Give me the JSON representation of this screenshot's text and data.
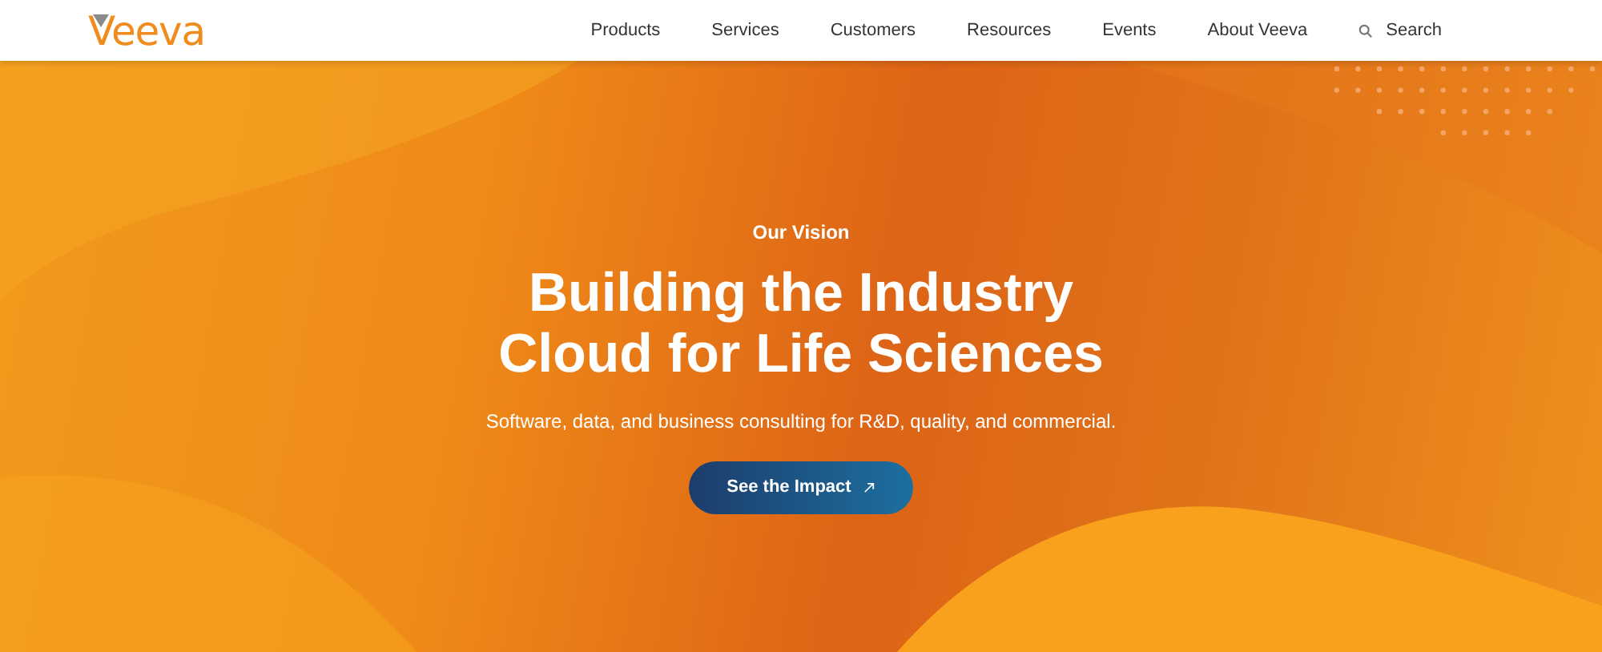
{
  "header": {
    "logo": "Veeva",
    "nav": [
      "Products",
      "Services",
      "Customers",
      "Resources",
      "Events",
      "About Veeva"
    ],
    "search": "Search"
  },
  "hero": {
    "eyebrow": "Our Vision",
    "title_lines": [
      "Building the Industry",
      "Cloud for Life Sciences"
    ],
    "subtitle": "Software, data, and business consulting for R&D, quality, and commercial.",
    "cta": "See the Impact"
  }
}
